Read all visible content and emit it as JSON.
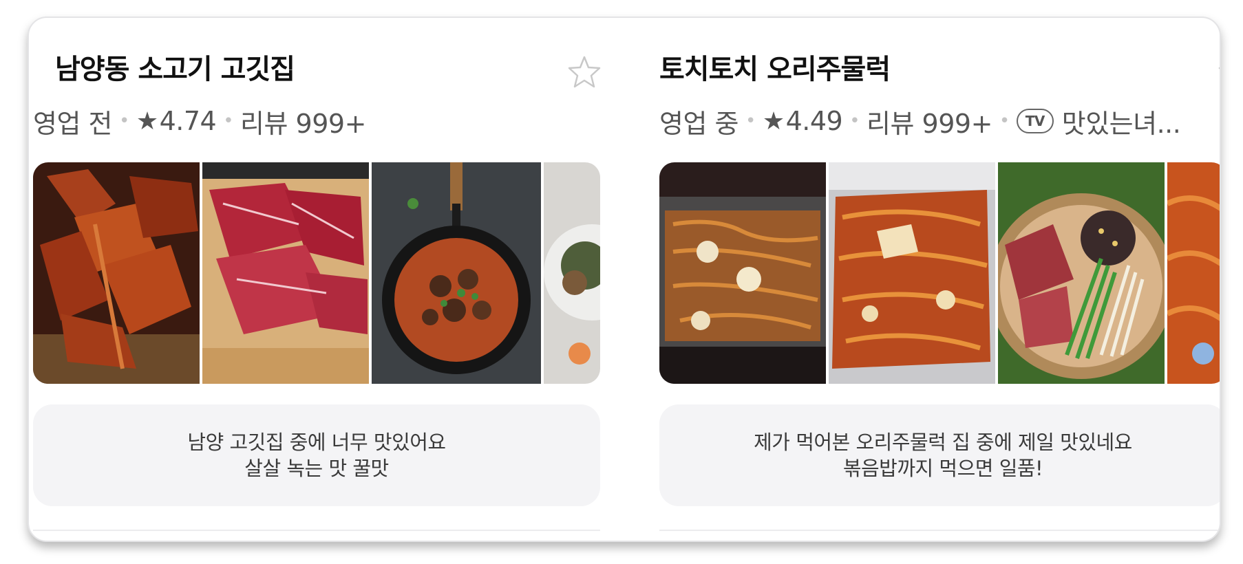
{
  "restaurants": [
    {
      "name": "남양동 소고기 고깃집",
      "status": "영업 전",
      "rating": "4.74",
      "reviews": "리뷰 999+",
      "review_lines": [
        "남양 고깃집 중에 너무 맛있어요",
        "살살 녹는 맛 꿀맛"
      ],
      "photos": [
        "photo-grilled-beef-strips",
        "photo-raw-marbled-beef",
        "photo-beef-stew-pan",
        "photo-side-dish"
      ]
    },
    {
      "name": "토치토치 오리주물럭",
      "status": "영업 중",
      "rating": "4.49",
      "reviews": "리뷰 999+",
      "tv_badge": "TV",
      "tv_show": "맛있는녀...",
      "review_lines": [
        "제가 먹어본 오리주물럭 집 중에 제일 맛있네요",
        "볶음밥까지 먹으면 일품!"
      ],
      "photos": [
        "photo-duck-on-grill",
        "photo-spicy-duck-foil",
        "photo-duck-hotpot",
        "photo-duck-closeup"
      ]
    }
  ],
  "icons": {
    "favorite": "star-outline-icon",
    "rating": "star-filled-icon",
    "gallery_indicator": "gallery-dot-icon"
  },
  "colors": {
    "review_bg": "#f4f4f6",
    "text_primary": "#111111",
    "text_secondary": "#555555"
  }
}
